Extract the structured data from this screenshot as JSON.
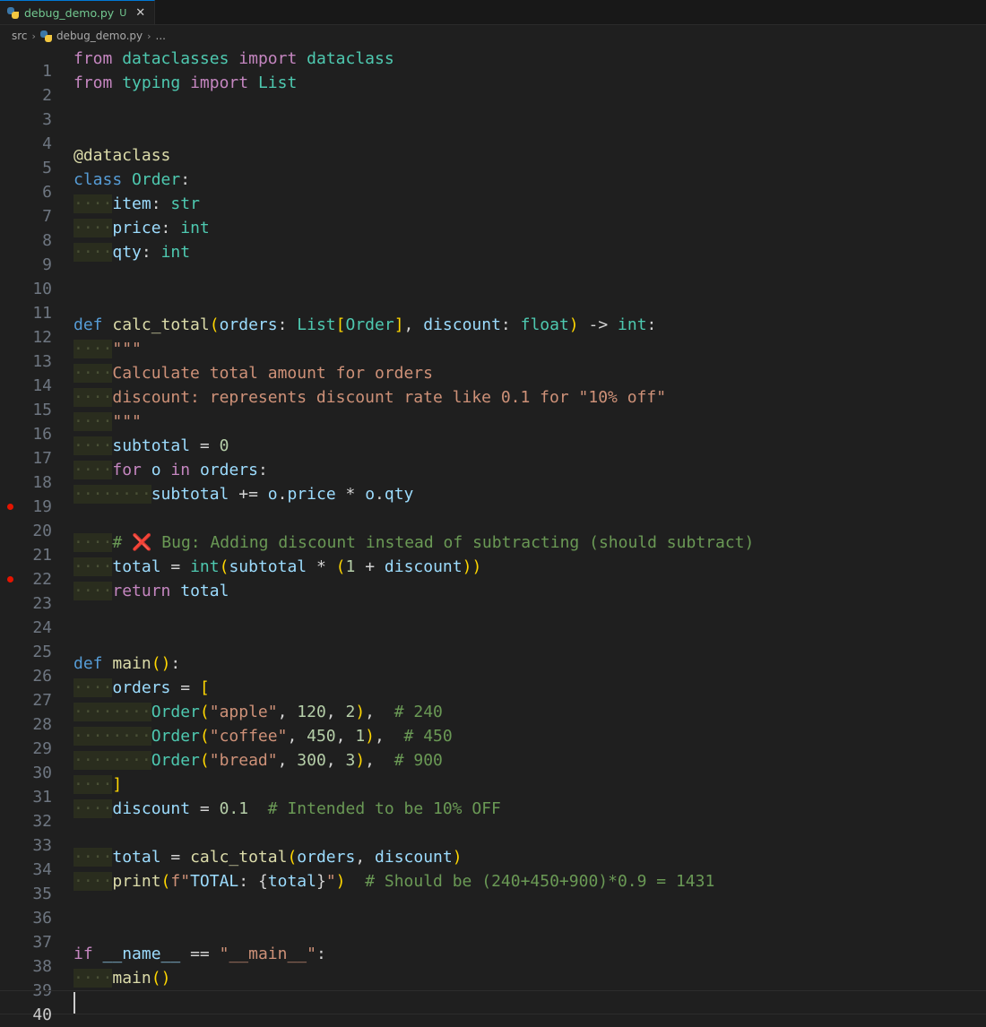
{
  "tab": {
    "filename": "debug_demo.py",
    "status": "U",
    "close": "✕"
  },
  "breadcrumb": {
    "folder": "src",
    "file": "debug_demo.py",
    "more": "..."
  },
  "colors": {
    "keyword": "#c586c0",
    "module": "#4ec9b0",
    "text": "#9cdcfe",
    "string": "#ce9178",
    "number": "#b5cea8",
    "comment": "#6a9955",
    "type": "#4ec9b0",
    "func": "#dcdcaa",
    "bracket": "#ffd700",
    "decl": "#569cd6",
    "punct": "#d4d4d4"
  },
  "lines": [
    {
      "n": "1",
      "indent": "",
      "text": "from dataclasses import dataclass"
    },
    {
      "n": "2",
      "indent": "",
      "text": "from typing import List"
    },
    {
      "n": "3",
      "indent": "",
      "text": ""
    },
    {
      "n": "4",
      "indent": "",
      "text": ""
    },
    {
      "n": "5",
      "indent": "",
      "text": "@dataclass"
    },
    {
      "n": "6",
      "indent": "",
      "text": "class Order:"
    },
    {
      "n": "7",
      "indent": "····",
      "text": "item: str"
    },
    {
      "n": "8",
      "indent": "····",
      "text": "price: int"
    },
    {
      "n": "9",
      "indent": "····",
      "text": "qty: int"
    },
    {
      "n": "10",
      "indent": "",
      "text": ""
    },
    {
      "n": "11",
      "indent": "",
      "text": ""
    },
    {
      "n": "12",
      "indent": "",
      "text": "def calc_total(orders: List[Order], discount: float) -> int:"
    },
    {
      "n": "13",
      "indent": "····",
      "text": "\"\"\""
    },
    {
      "n": "14",
      "indent": "····",
      "text": "Calculate total amount for orders"
    },
    {
      "n": "15",
      "indent": "····",
      "text": "discount: represents discount rate like 0.1 for \"10% off\""
    },
    {
      "n": "16",
      "indent": "····",
      "text": "\"\"\""
    },
    {
      "n": "17",
      "indent": "····",
      "text": "subtotal = 0"
    },
    {
      "n": "18",
      "indent": "····",
      "text": "for o in orders:"
    },
    {
      "n": "19",
      "indent": "········",
      "text": "subtotal += o.price * o.qty",
      "breakpoint": true
    },
    {
      "n": "20",
      "indent": "",
      "text": ""
    },
    {
      "n": "21",
      "indent": "····",
      "text": "# ❌ Bug: Adding discount instead of subtracting (should subtract)"
    },
    {
      "n": "22",
      "indent": "····",
      "text": "total = int(subtotal * (1 + discount))",
      "breakpoint": true
    },
    {
      "n": "23",
      "indent": "····",
      "text": "return total"
    },
    {
      "n": "24",
      "indent": "",
      "text": ""
    },
    {
      "n": "25",
      "indent": "",
      "text": ""
    },
    {
      "n": "26",
      "indent": "",
      "text": "def main():"
    },
    {
      "n": "27",
      "indent": "····",
      "text": "orders = ["
    },
    {
      "n": "28",
      "indent": "········",
      "text": "Order(\"apple\", 120, 2),  # 240"
    },
    {
      "n": "29",
      "indent": "········",
      "text": "Order(\"coffee\", 450, 1),  # 450"
    },
    {
      "n": "30",
      "indent": "········",
      "text": "Order(\"bread\", 300, 3),  # 900"
    },
    {
      "n": "31",
      "indent": "····",
      "text": "]"
    },
    {
      "n": "32",
      "indent": "····",
      "text": "discount = 0.1  # Intended to be 10% OFF"
    },
    {
      "n": "33",
      "indent": "",
      "text": ""
    },
    {
      "n": "34",
      "indent": "····",
      "text": "total = calc_total(orders, discount)"
    },
    {
      "n": "35",
      "indent": "····",
      "text": "print(f\"TOTAL: {total}\")  # Should be (240+450+900)*0.9 = 1431"
    },
    {
      "n": "36",
      "indent": "",
      "text": ""
    },
    {
      "n": "37",
      "indent": "",
      "text": ""
    },
    {
      "n": "38",
      "indent": "",
      "text": "if __name__ == \"__main__\":"
    },
    {
      "n": "39",
      "indent": "····",
      "text": "main()"
    },
    {
      "n": "40",
      "indent": "",
      "text": "",
      "current": true
    }
  ]
}
